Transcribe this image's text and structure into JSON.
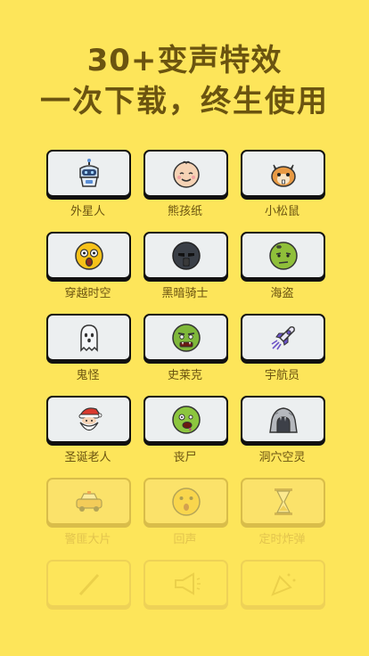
{
  "header": {
    "line1": "30+变声特效",
    "line2": "一次下载，终生使用"
  },
  "effects": [
    {
      "label": "外星人",
      "icon": "robot-icon"
    },
    {
      "label": "熊孩纸",
      "icon": "baby-face-icon"
    },
    {
      "label": "小松鼠",
      "icon": "squirrel-icon"
    },
    {
      "label": "穿越时空",
      "icon": "shocked-face-icon"
    },
    {
      "label": "黑暗骑士",
      "icon": "dark-knight-helmet-icon"
    },
    {
      "label": "海盗",
      "icon": "pirate-face-icon"
    },
    {
      "label": "鬼怪",
      "icon": "ghost-icon"
    },
    {
      "label": "史莱克",
      "icon": "ogre-face-icon"
    },
    {
      "label": "宇航员",
      "icon": "rocket-icon"
    },
    {
      "label": "圣诞老人",
      "icon": "santa-icon"
    },
    {
      "label": "丧尸",
      "icon": "zombie-face-icon"
    },
    {
      "label": "洞穴空灵",
      "icon": "cave-icon"
    },
    {
      "label": "警匪大片",
      "icon": "police-car-icon"
    },
    {
      "label": "回声",
      "icon": "echo-face-icon"
    },
    {
      "label": "定时炸弹",
      "icon": "hourglass-icon"
    },
    {
      "label": "",
      "icon": "wand-icon"
    },
    {
      "label": "",
      "icon": "megaphone-icon"
    },
    {
      "label": "",
      "icon": "party-popper-icon"
    }
  ]
}
